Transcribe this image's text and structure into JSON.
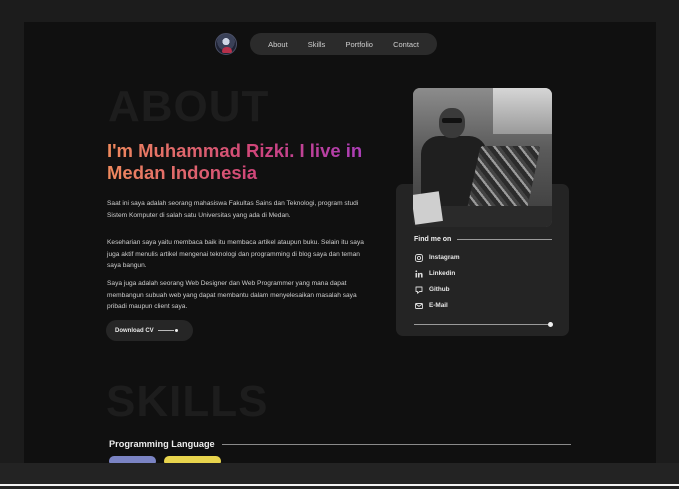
{
  "nav": {
    "items": [
      "About",
      "Skills",
      "Portfolio",
      "Contact"
    ]
  },
  "about": {
    "ghost_title": "ABOUT",
    "headline": "I'm Muhammad Rizki. I live in Medan Indonesia",
    "paragraphs": [
      "Saat ini saya adalah seorang mahasiswa Fakultas Sains dan Teknologi, program studi Sistem Komputer di salah satu Universitas yang ada di Medan.",
      "Keseharian saya yaitu membaca baik itu membaca artikel ataupun buku. Selain itu saya juga aktif menulis artikel mengenai teknologi dan programming di blog saya dan teman saya bangun.",
      "Saya juga adalah seorang Web Designer dan Web Programmer yang mana dapat membangun subuah web yang dapat membantu dalam menyelesaikan masalah saya pribadi maupun client saya."
    ],
    "cv_button": "Download CV"
  },
  "profile_card": {
    "find_me_title": "Find me on",
    "links": [
      {
        "label": "Instagram",
        "icon": "instagram-icon"
      },
      {
        "label": "Linkedin",
        "icon": "linkedin-icon"
      },
      {
        "label": "Github",
        "icon": "github-icon"
      },
      {
        "label": "E-Mail",
        "icon": "email-icon"
      }
    ]
  },
  "skills": {
    "ghost_title": "SKILLS",
    "section_title": "Programming Language"
  },
  "colors": {
    "background": "#101010",
    "headline_gradient": [
      "#f08a5d",
      "#d0457a",
      "#a63cc0"
    ],
    "chip_php": "#7b84c4",
    "chip_js": "#e8d44d"
  }
}
